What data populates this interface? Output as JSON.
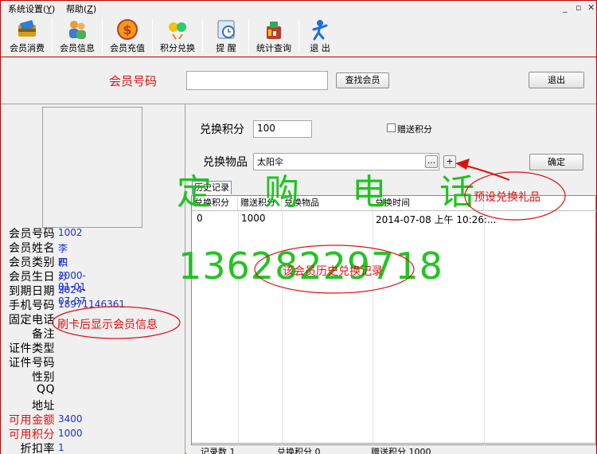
{
  "menu": {
    "system": "系统设置",
    "system_key": "Y",
    "help": "帮助",
    "help_key": "Z"
  },
  "toolbar": {
    "items": [
      {
        "label": "会员消费",
        "icon": "card-wallet-icon"
      },
      {
        "label": "会员信息",
        "icon": "members-icon"
      },
      {
        "label": "会员充值",
        "icon": "dollar-coin-icon"
      },
      {
        "label": "积分兑换",
        "icon": "exchange-icon"
      },
      {
        "label": "提 醒",
        "icon": "reminder-icon"
      },
      {
        "label": "统计查询",
        "icon": "statistics-icon"
      },
      {
        "label": "退 出",
        "icon": "exit-icon"
      }
    ]
  },
  "search": {
    "label": "会员号码",
    "value": "",
    "find_button": "查找会员",
    "exit_button": "退出"
  },
  "member": {
    "fields": [
      {
        "label": "会员号码",
        "value": "1002",
        "highlight": false
      },
      {
        "label": "会员姓名",
        "value": "李四",
        "highlight": false
      },
      {
        "label": "会员类别",
        "value": "积分卡",
        "highlight": false
      },
      {
        "label": "会员生日",
        "value": "2000-01-01",
        "highlight": false
      },
      {
        "label": "到期日期",
        "value": "2024-07-07",
        "highlight": false
      },
      {
        "label": "手机号码",
        "value": "18971146361",
        "highlight": false
      },
      {
        "label": "固定电话",
        "value": "",
        "highlight": false
      },
      {
        "label": "备注",
        "value": "",
        "highlight": false
      },
      {
        "label": "证件类型",
        "value": "",
        "highlight": false
      },
      {
        "label": "证件号码",
        "value": "",
        "highlight": false
      },
      {
        "label": "性别",
        "value": "",
        "highlight": false
      },
      {
        "label": "QQ",
        "value": "",
        "highlight": false
      },
      {
        "label": "地址",
        "value": "",
        "highlight": false
      },
      {
        "label": "可用金额",
        "value": "3400",
        "highlight": true
      },
      {
        "label": "可用积分",
        "value": "1000",
        "highlight": true
      },
      {
        "label": "折扣率",
        "value": "1",
        "highlight": false
      },
      {
        "label": "积分率",
        "value": "1",
        "highlight": false
      }
    ]
  },
  "exchange": {
    "points_label": "兑换积分",
    "points_value": "100",
    "gift_checkbox_label": "赠送积分",
    "gift_checked": false,
    "item_label": "兑换物品",
    "item_value": "太阳伞",
    "browse_button": "...",
    "add_button": "+",
    "confirm_button": "确定"
  },
  "history": {
    "tab": "历史记录",
    "columns": [
      "兑换积分",
      "赠送积分",
      "兑换物品",
      "兑换时间"
    ],
    "rows": [
      [
        "0",
        "1000",
        "",
        "2014-07-08 上午 10:26:..."
      ]
    ]
  },
  "status": {
    "count_label": "记录数",
    "count": "1",
    "points_label": "兑换积分",
    "points": "0",
    "gift_label": "赠送积分",
    "gift": "1000"
  },
  "overlay": {
    "watermark_title": "定 购 电 话",
    "watermark_phone": "13628229718",
    "note_member_info": "刷卡后显示会员信息",
    "note_history": "该会员历史兑换记录",
    "note_gift": "预设兑换礼品"
  }
}
